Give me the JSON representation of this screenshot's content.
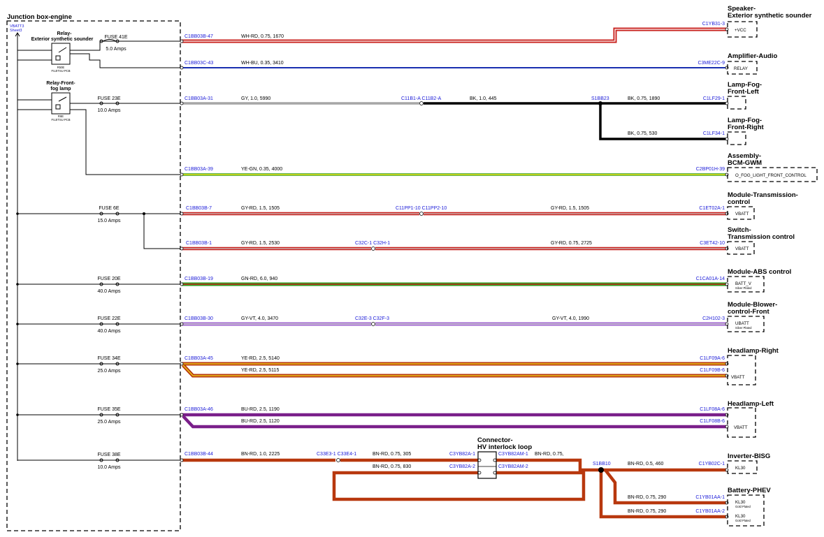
{
  "junction_box": {
    "title": "Junction box-engine",
    "vbatt": "VBATT3",
    "sheet": "Sheet3",
    "relay1_title": [
      "Relay-",
      "Exterior synthetic sounder"
    ],
    "relay1_id": "R50E",
    "relay1_note": "FUJITSU PCB",
    "relay2_title": [
      "Relay-Front-",
      "fog lamp"
    ],
    "relay2_id": "R6E",
    "relay2_note": "FUJITSU PCB"
  },
  "fuses": [
    {
      "name": "FUSE 41E",
      "amps": "5.0 Amps"
    },
    {
      "name": "FUSE 23E",
      "amps": "10.0 Amps"
    },
    {
      "name": "FUSE 6E",
      "amps": "15.0 Amps"
    },
    {
      "name": "FUSE 20E",
      "amps": "40.0 Amps"
    },
    {
      "name": "FUSE 22E",
      "amps": "40.0 Amps"
    },
    {
      "name": "FUSE 34E",
      "amps": "25.0 Amps"
    },
    {
      "name": "FUSE 35E",
      "amps": "25.0 Amps"
    },
    {
      "name": "FUSE 38E",
      "amps": "10.0 Amps"
    }
  ],
  "connectors": {
    "c1": "C1BB03B-47",
    "c2": "C1BB03C-43",
    "c3": "C1BB03A-31",
    "c4": "C1BB03A-39",
    "c5": "C1BB03B-7",
    "c6": "C1BB03B-1",
    "c7": "C1BB03B-19",
    "c8": "C1BB03B-30",
    "c9": "C1BB03A-45",
    "c10": "C1BB03A-46",
    "c11": "C1BB03B-44",
    "inline_11b": "C11B1-A  C11B2-A",
    "splice_s1bb23": "S1BB23",
    "inline_pp": "C11PP1-10  C11PP2-10",
    "inline_32c": "C32C-1  C32H-1",
    "inline_32e": "C32E-3  C32F-3",
    "inline_33e": "C33E3-1  C33E4-1",
    "splice_s1bb10": "S1BB10",
    "c3yb82a1": "C3YB82A-1",
    "c3yb82a2": "C3YB82A-2",
    "c3yb82am1": "C3YB82AM-1",
    "c3yb82am2": "C3YB82AM-2"
  },
  "wires": {
    "w1": "WH-RD,  0.75,  1670",
    "w2": "WH-BU,  0.35,  3410",
    "w3a": "GY,  1.0,  5990",
    "w3b": "BK,  1.0,  445",
    "w3c": "BK,  0.75,  1890",
    "w3d": "BK,  0.75,  530",
    "w4": "YE-GN,  0.35,  4000",
    "w5a": "GY-RD,  1.5,  1505",
    "w5b": "GY-RD,  1.5,  1505",
    "w6a": "GY-RD,  1.5,  2530",
    "w6b": "GY-RD,  0.75,  2725",
    "w7": "GN-RD,  6.0,  940",
    "w8a": "GY-VT,  4.0,  3470",
    "w8b": "GY-VT,  4.0,  1990",
    "w9a": "YE-RD,  2.5,  5140",
    "w9b": "YE-RD,  2.5,  5115",
    "w10a": "BU-RD,  2.5,  1190",
    "w10b": "BU-RD,  2.5,  1120",
    "w11a": "BN-RD,  1.0,  2225",
    "w11b": "BN-RD,  0.75,  305",
    "w11c": "BN-RD,  0.75,  830",
    "w11d": "BN-RD,  0.75,",
    "w11e": "BN-RD,  0.5,  460",
    "w11f": "BN-RD,  0.75,  290",
    "w11g": "BN-RD,  0.75,  290"
  },
  "interlock": {
    "title": [
      "Connector-",
      "HV interlock loop"
    ]
  },
  "components": [
    {
      "title": [
        "Speaker-",
        "Exterior synthetic sounder"
      ],
      "pin_conn": "C1YB31-3",
      "pin_label": "+VCC"
    },
    {
      "title": [
        "Amplifier-Audio"
      ],
      "pin_conn": "C3ME22C-9",
      "pin_label": "RELAY"
    },
    {
      "title": [
        "Lamp-Fog-",
        "Front-Left"
      ],
      "pin_conn": "C1LF29-1"
    },
    {
      "title": [
        "Lamp-Fog-",
        "Front-Right"
      ],
      "pin_conn": "C1LF34-1"
    },
    {
      "title": [
        "Assembly-",
        "BCM-GWM"
      ],
      "pin_conn": "C2BP01H-39",
      "pin_label": "O_FOG_LIGHT_FRONT_CONTROL"
    },
    {
      "title": [
        "Module-Transmission-",
        "control"
      ],
      "pin_conn": "C1ET02A-1",
      "pin_label": "VBATT"
    },
    {
      "title": [
        "Switch-",
        "Transmission control"
      ],
      "pin_conn": "C3ET42-10",
      "pin_label": "VBATT"
    },
    {
      "title": [
        "Module-ABS control"
      ],
      "pin_conn": "C1CA01A-14",
      "pin_label": "BATT_V",
      "pin_note": "Silver Plated"
    },
    {
      "title": [
        "Module-Blower-",
        "control-Front"
      ],
      "pin_conn": "C2H102-3",
      "pin_label": "UBATT",
      "pin_note": "Silver Plated"
    },
    {
      "title": [
        "Headlamp-Right"
      ],
      "pin_conn": "C1LF09A-6",
      "pin_conn2": "C1LF09B-6",
      "pin_label": "VBATT"
    },
    {
      "title": [
        "Headlamp-Left"
      ],
      "pin_conn": "C1LF08A-6",
      "pin_conn2": "C1LF08B-6",
      "pin_label": "VBATT"
    },
    {
      "title": [
        "Inverter-BISG"
      ],
      "pin_conn": "C1YB02C-1",
      "pin_label": "KL30"
    },
    {
      "title": [
        "Battery-PHEV"
      ],
      "pin_conn": "C1YB01AA-1",
      "pin_conn2": "C1YB01AA-2",
      "pin_label": "KL30",
      "pin_note": "Gold Plated",
      "pin_label2": "KL30",
      "pin_note2": "Gold Plated"
    }
  ],
  "colors": {
    "red": "#c8201c",
    "blue": "#1a2fb0",
    "gray": "#a6a6a6",
    "black": "#000000",
    "green": "#2e9e1f",
    "yellow": "#e8c21a",
    "violet": "#a066d0",
    "brown": "#b8380e",
    "label_blue": "#1a1ad8"
  }
}
